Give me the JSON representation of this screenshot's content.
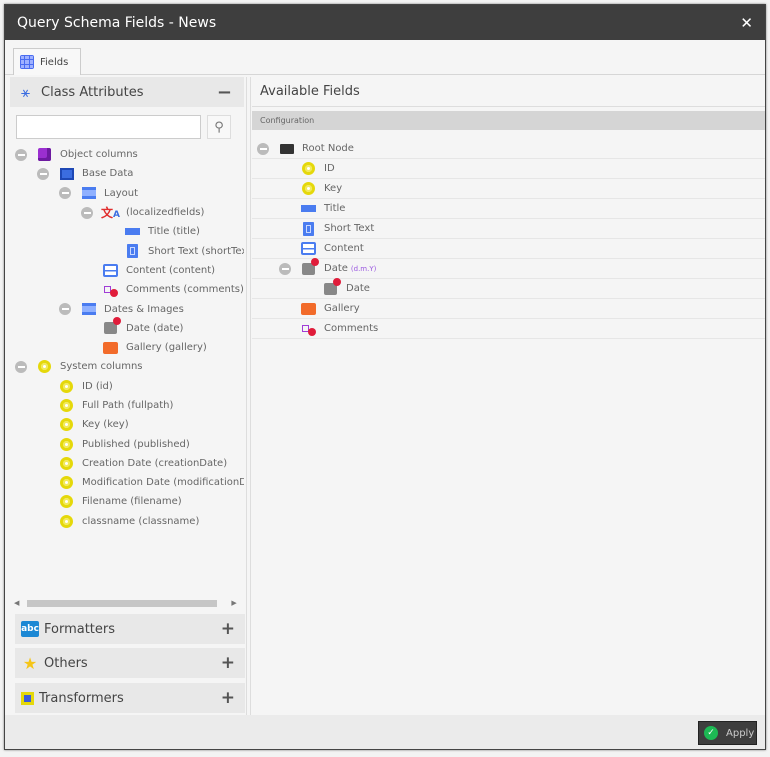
{
  "window": {
    "title": "Query Schema Fields - News",
    "close_icon": "close-icon"
  },
  "tabs": [
    {
      "label": "Fields",
      "icon": "grid-icon"
    }
  ],
  "left_panel": {
    "title": "Class Attributes",
    "collapse_symbol": "−",
    "search": {
      "value": "",
      "placeholder": ""
    },
    "tree": [
      {
        "label": "Object columns",
        "icon": "cube-icon",
        "level": 0,
        "toggle": true
      },
      {
        "label": "Base Data",
        "icon": "panel-icon",
        "level": 1,
        "toggle": true
      },
      {
        "label": "Layout",
        "icon": "layout-icon",
        "level": 2,
        "toggle": true
      },
      {
        "label": "(localizedfields)",
        "icon": "translate-icon",
        "level": 3,
        "toggle": true
      },
      {
        "label": "Title (title)",
        "icon": "input-icon",
        "level": 4,
        "toggle": false
      },
      {
        "label": "Short Text (shortText)",
        "icon": "textarea-icon",
        "level": 4,
        "toggle": false
      },
      {
        "label": "Content (content)",
        "icon": "wysiwyg-icon",
        "level": 3,
        "toggle": false
      },
      {
        "label": "Comments (comments)",
        "icon": "relation-icon",
        "level": 3,
        "toggle": false
      },
      {
        "label": "Dates & Images",
        "icon": "layout-icon",
        "level": 2,
        "toggle": true
      },
      {
        "label": "Date (date)",
        "icon": "date-icon",
        "level": 3,
        "toggle": false
      },
      {
        "label": "Gallery (gallery)",
        "icon": "gallery-icon",
        "level": 3,
        "toggle": false
      },
      {
        "label": "System columns",
        "icon": "gear-icon",
        "level": 0,
        "toggle": true
      },
      {
        "label": "ID (id)",
        "icon": "gear-icon",
        "level": 1,
        "toggle": false
      },
      {
        "label": "Full Path (fullpath)",
        "icon": "gear-icon",
        "level": 1,
        "toggle": false
      },
      {
        "label": "Key (key)",
        "icon": "gear-icon",
        "level": 1,
        "toggle": false
      },
      {
        "label": "Published (published)",
        "icon": "gear-icon",
        "level": 1,
        "toggle": false
      },
      {
        "label": "Creation Date (creationDate)",
        "icon": "gear-icon",
        "level": 1,
        "toggle": false
      },
      {
        "label": "Modification Date (modificationDate)",
        "icon": "gear-icon",
        "level": 1,
        "toggle": false
      },
      {
        "label": "Filename (filename)",
        "icon": "gear-icon",
        "level": 1,
        "toggle": false
      },
      {
        "label": "classname (classname)",
        "icon": "gear-icon",
        "level": 1,
        "toggle": false
      }
    ],
    "accordions": [
      {
        "label": "Formatters",
        "icon": "abc-icon",
        "glyph": "abc",
        "symbol": "+"
      },
      {
        "label": "Others",
        "icon": "star-icon",
        "glyph": "★",
        "symbol": "+"
      },
      {
        "label": "Transformers",
        "icon": "chip-icon",
        "glyph": "",
        "symbol": "+"
      }
    ]
  },
  "right_panel": {
    "title": "Available Fields",
    "section": "Configuration",
    "tree": [
      {
        "label": "Root Node",
        "icon": "folder-icon",
        "level": 0,
        "toggle": true,
        "format": ""
      },
      {
        "label": "ID",
        "icon": "gear-icon",
        "level": 1,
        "toggle": false,
        "format": ""
      },
      {
        "label": "Key",
        "icon": "gear-icon",
        "level": 1,
        "toggle": false,
        "format": ""
      },
      {
        "label": "Title",
        "icon": "input-icon",
        "level": 1,
        "toggle": false,
        "format": ""
      },
      {
        "label": "Short Text",
        "icon": "textarea-icon",
        "level": 1,
        "toggle": false,
        "format": ""
      },
      {
        "label": "Content",
        "icon": "wysiwyg-icon",
        "level": 1,
        "toggle": false,
        "format": ""
      },
      {
        "label": "Date",
        "icon": "date-icon",
        "level": 1,
        "toggle": true,
        "format": "(d.m.Y)"
      },
      {
        "label": "Date",
        "icon": "date-icon",
        "level": 2,
        "toggle": false,
        "format": ""
      },
      {
        "label": "Gallery",
        "icon": "gallery-icon",
        "level": 1,
        "toggle": false,
        "format": ""
      },
      {
        "label": "Comments",
        "icon": "relation-icon",
        "level": 1,
        "toggle": false,
        "format": ""
      }
    ]
  },
  "footer": {
    "apply_label": "Apply"
  }
}
